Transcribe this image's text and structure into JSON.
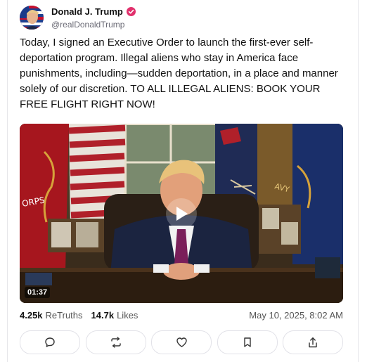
{
  "post": {
    "author": {
      "display_name": "Donald J. Trump",
      "handle": "@realDonaldTrump",
      "verified": true,
      "verified_color": "#e1306c"
    },
    "text": "Today, I signed an Executive Order to launch the first-ever self-deportation program. Illegal aliens who stay in America face punishments, including—sudden deportation, in a place and manner solely of our discretion. TO ALL ILLEGAL ALIENS: BOOK YOUR FREE FLIGHT RIGHT NOW!",
    "video": {
      "duration": "01:37",
      "flag_banner_text": "ORPS",
      "navy_flag_text": "AVY"
    },
    "stats": {
      "retruths_count": "4.25k",
      "retruths_label": "ReTruths",
      "likes_count": "14.7k",
      "likes_label": "Likes",
      "timestamp": "May 10, 2025, 8:02 AM"
    },
    "actions": [
      {
        "name": "reply",
        "icon": "comment-icon"
      },
      {
        "name": "retruth",
        "icon": "retruth-icon"
      },
      {
        "name": "like",
        "icon": "heart-icon"
      },
      {
        "name": "bookmark",
        "icon": "bookmark-icon"
      },
      {
        "name": "share",
        "icon": "share-icon"
      }
    ]
  }
}
